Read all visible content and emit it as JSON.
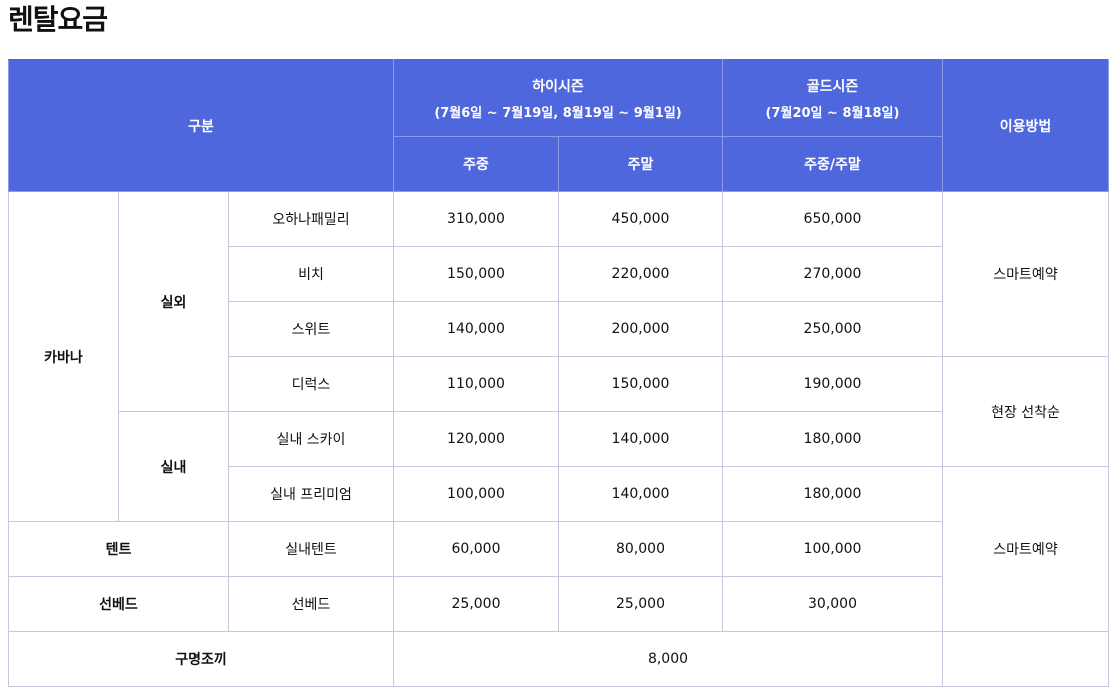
{
  "page_title": "렌탈요금",
  "header": {
    "category": "구분",
    "high_season": {
      "title": "하이시즌",
      "dates": "(7월6일 ~ 7월19일, 8월19일 ~ 9월1일)"
    },
    "gold_season": {
      "title": "골드시즌",
      "dates": "(7월20일 ~ 8월18일)"
    },
    "usage": "이용방법",
    "weekday": "주중",
    "weekend": "주말",
    "weekday_weekend": "주중/주말"
  },
  "groups": {
    "cabana": "카바나",
    "outdoor": "실외",
    "indoor": "실내",
    "tent": "텐트",
    "sunbed": "선베드",
    "life_jacket": "구명조끼"
  },
  "rows": [
    {
      "item": "오하나패밀리",
      "high_weekday": "310,000",
      "high_weekend": "450,000",
      "gold": "650,000"
    },
    {
      "item": "비치",
      "high_weekday": "150,000",
      "high_weekend": "220,000",
      "gold": "270,000"
    },
    {
      "item": "스위트",
      "high_weekday": "140,000",
      "high_weekend": "200,000",
      "gold": "250,000"
    },
    {
      "item": "디럭스",
      "high_weekday": "110,000",
      "high_weekend": "150,000",
      "gold": "190,000"
    },
    {
      "item": "실내 스카이",
      "high_weekday": "120,000",
      "high_weekend": "140,000",
      "gold": "180,000"
    },
    {
      "item": "실내 프리미엄",
      "high_weekday": "100,000",
      "high_weekend": "140,000",
      "gold": "180,000"
    },
    {
      "item": "실내텐트",
      "high_weekday": "60,000",
      "high_weekend": "80,000",
      "gold": "100,000"
    },
    {
      "item": "선베드",
      "high_weekday": "25,000",
      "high_weekend": "25,000",
      "gold": "30,000"
    }
  ],
  "usage_methods": [
    "스마트예약",
    "현장 선착순",
    "스마트예약"
  ],
  "life_jacket_price": "8,000"
}
